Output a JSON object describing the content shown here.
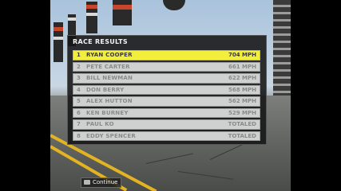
{
  "results": {
    "title": "RACE RESULTS",
    "rows": [
      {
        "pos": "1",
        "name": "RYAN COOPER",
        "speed": "704 MPH",
        "highlight": true
      },
      {
        "pos": "2",
        "name": "PETE CARTER",
        "speed": "661 MPH"
      },
      {
        "pos": "3",
        "name": "BILL NEWMAN",
        "speed": "622 MPH"
      },
      {
        "pos": "4",
        "name": "DON BERRY",
        "speed": "568 MPH"
      },
      {
        "pos": "5",
        "name": "ALEX HUTTON",
        "speed": "562 MPH"
      },
      {
        "pos": "6",
        "name": "KEN BURNEY",
        "speed": "529 MPH"
      },
      {
        "pos": "7",
        "name": "PAUL KO",
        "speed": "TOTALED"
      },
      {
        "pos": "8",
        "name": "EDDY SPENCER",
        "speed": "TOTALED"
      }
    ]
  },
  "continue_label": "Continue",
  "colors": {
    "highlight_row": "#f3ee3c",
    "row": "#cfd0d0",
    "panel": "#141414"
  }
}
